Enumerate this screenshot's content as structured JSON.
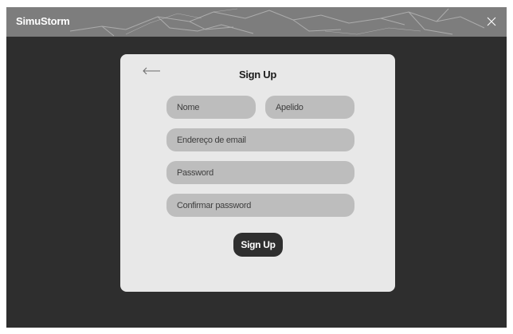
{
  "window": {
    "title": "SimuStorm",
    "close_icon": "close-icon"
  },
  "signup_form": {
    "back_icon": "arrow-left-icon",
    "title": "Sign Up",
    "first_name_placeholder": "Nome",
    "last_name_placeholder": "Apelido",
    "email_placeholder": "Endereço de email",
    "password_placeholder": "Password",
    "confirm_password_placeholder": "Confirmar password",
    "submit_label": "Sign Up"
  },
  "colors": {
    "window_background": "#2e2e2e",
    "titlebar": "#7d7d7d",
    "card": "#e8e8e8",
    "input": "#bdbdbd",
    "button": "#2f2f2f"
  }
}
